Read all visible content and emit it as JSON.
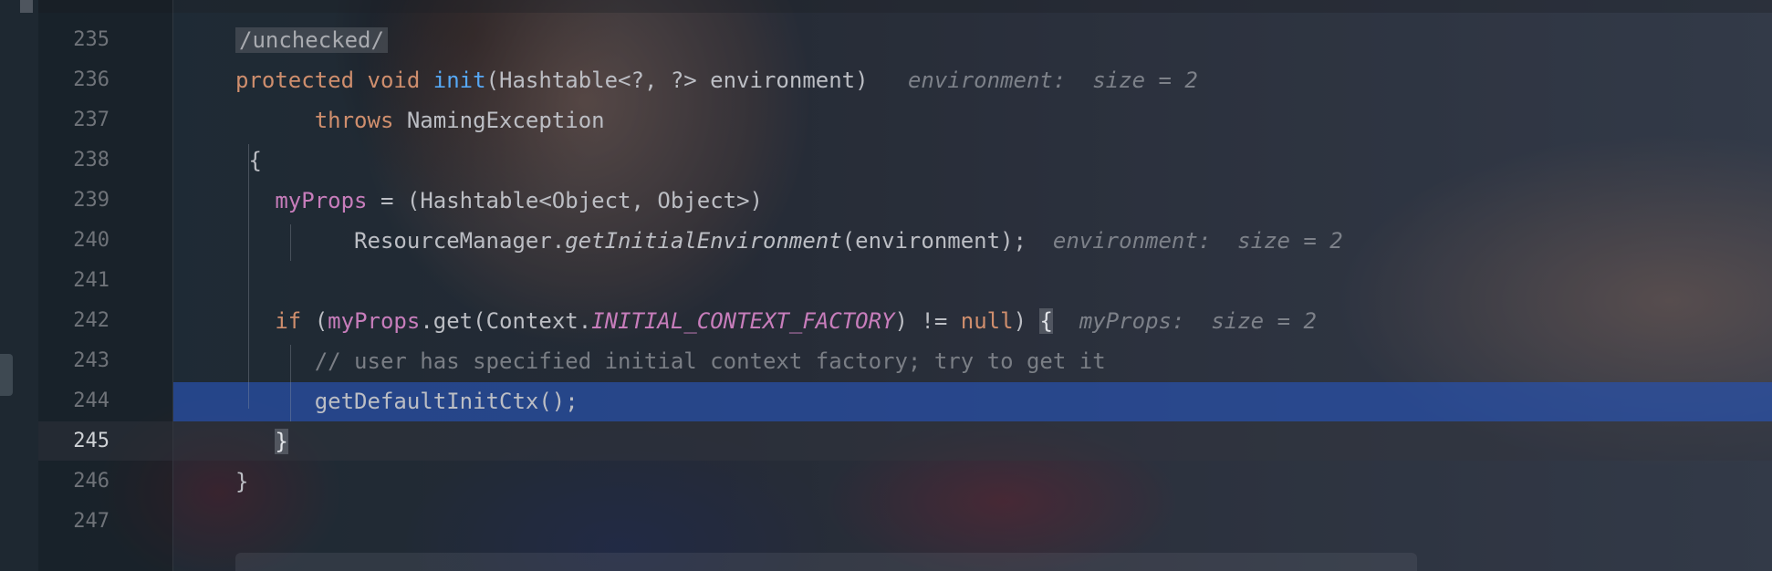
{
  "editor": {
    "line_numbers": [
      "235",
      "236",
      "237",
      "238",
      "239",
      "240",
      "241",
      "242",
      "243",
      "244",
      "245",
      "246",
      "247"
    ],
    "current_line": "245",
    "execution_line": "244",
    "lines": {
      "l235": {
        "annotation": "/unchecked/"
      },
      "l236": {
        "kw_protected": "protected",
        "kw_void": "void",
        "method_name": "init",
        "params": "(Hashtable<?, ?> environment)",
        "hint": "environment:  size = 2"
      },
      "l237": {
        "kw_throws": "throws",
        "exception": "NamingException"
      },
      "l238": {
        "brace": "{"
      },
      "l239": {
        "field": "myProps",
        "rest": " = (Hashtable<Object, Object>)"
      },
      "l240": {
        "class_ref": "ResourceManager.",
        "static_call": "getInitialEnvironment",
        "args": "(environment);",
        "hint": "environment:  size = 2"
      },
      "l242": {
        "kw_if": "if",
        "open": " (",
        "field": "myProps",
        "call": ".get(Context.",
        "constant": "INITIAL_CONTEXT_FACTORY",
        "compare": ") != ",
        "kw_null": "null",
        "close": ") ",
        "brace": "{",
        "hint": "myProps:  size = 2"
      },
      "l243": {
        "comment": "// user has specified initial context factory; try to get it"
      },
      "l244": {
        "call": "getDefaultInitCtx();"
      },
      "l245": {
        "brace": "}"
      },
      "l246": {
        "brace": "}"
      }
    }
  },
  "colors": {
    "keyword": "#cf8e6d",
    "method_declaration": "#56a8f5",
    "field": "#c77dbb",
    "comment": "#7a7e85",
    "default_text": "#bcbec4",
    "execution_highlight": "#2b52a8"
  }
}
